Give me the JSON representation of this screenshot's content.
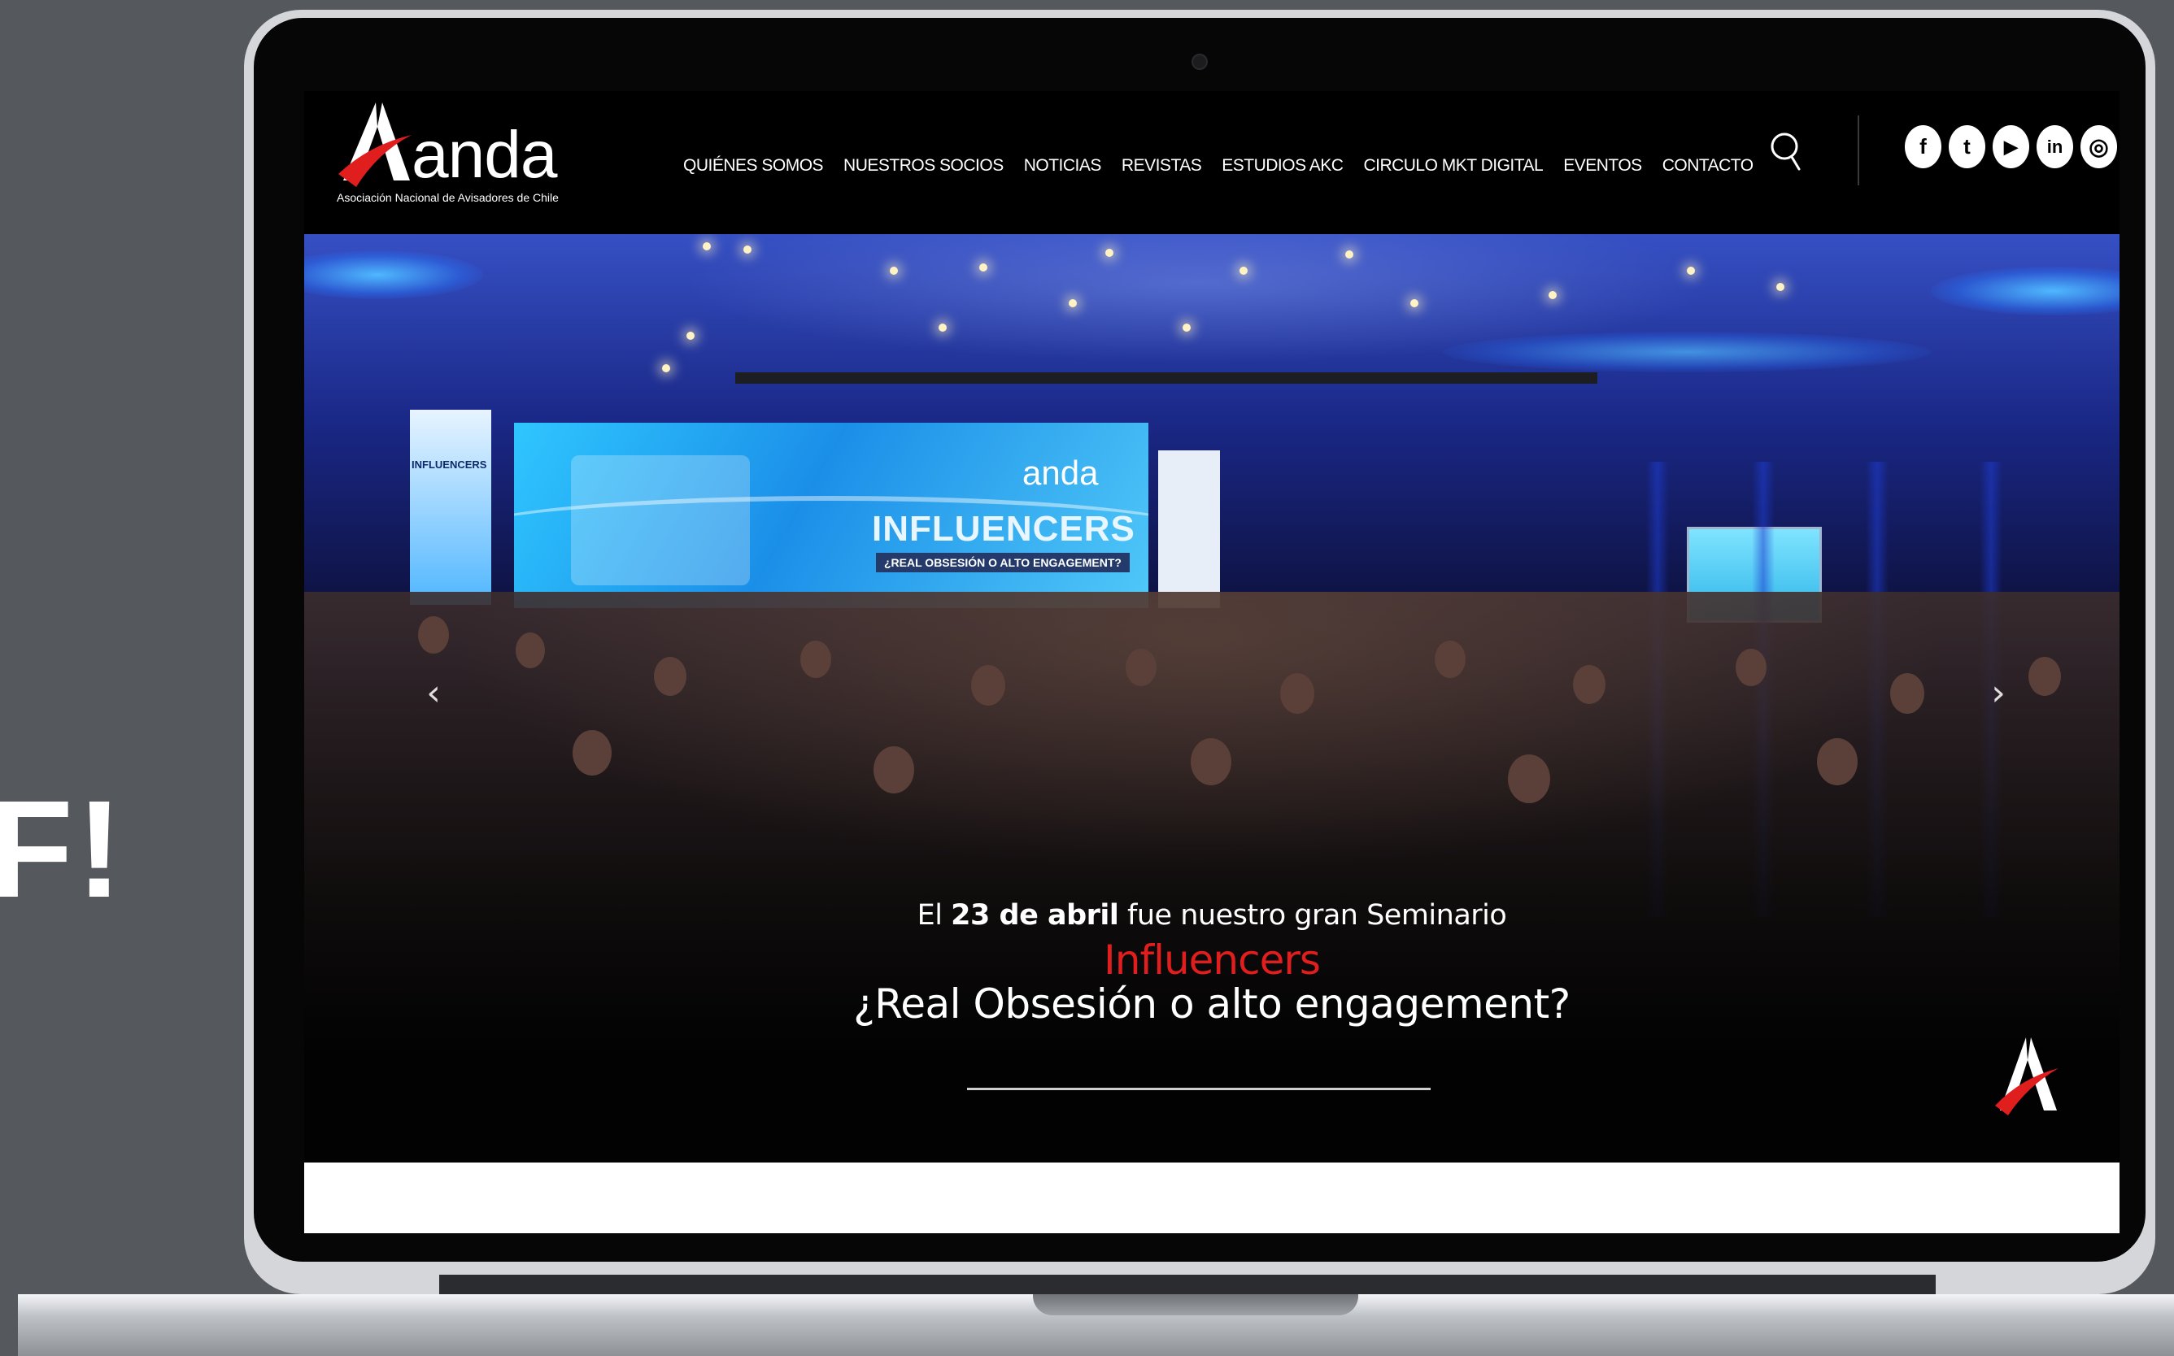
{
  "background_text": "F!",
  "site": {
    "logo": {
      "word": "anda",
      "tagline": "Asociación Nacional de Avisadores de Chile"
    },
    "nav": [
      {
        "label": "QUIÉNES SOMOS"
      },
      {
        "label": "NUESTROS SOCIOS"
      },
      {
        "label": "NOTICIAS"
      },
      {
        "label": "REVISTAS"
      },
      {
        "label": "ESTUDIOS AKC"
      },
      {
        "label": "CIRCULO MKT DIGITAL"
      },
      {
        "label": "EVENTOS"
      },
      {
        "label": "CONTACTO"
      }
    ],
    "search_icon": "search-icon",
    "social": [
      {
        "icon": "facebook-icon",
        "glyph": "f"
      },
      {
        "icon": "twitter-icon",
        "glyph": "t"
      },
      {
        "icon": "youtube-icon",
        "glyph": "▶"
      },
      {
        "icon": "linkedin-icon",
        "glyph": "in"
      },
      {
        "icon": "instagram-icon",
        "glyph": "◎"
      }
    ]
  },
  "hero": {
    "stage_screen": {
      "brand": "anda",
      "title": "INFLUENCERS",
      "subtitle": "¿REAL OBSESIÓN O ALTO ENGAGEMENT?"
    },
    "banner_left_text": "INFLUENCERS",
    "caption": {
      "line1_prefix": "El ",
      "line1_bold": "23 de abril",
      "line1_suffix": " fue nuestro gran Seminario",
      "line2": "Influencers",
      "line3": "¿Real Obsesión o alto engagement?"
    },
    "prev_arrow": "‹",
    "next_arrow": "›"
  },
  "colors": {
    "accent_red": "#e01e1e",
    "header_bg": "#000000",
    "page_bg": "#55595e"
  }
}
